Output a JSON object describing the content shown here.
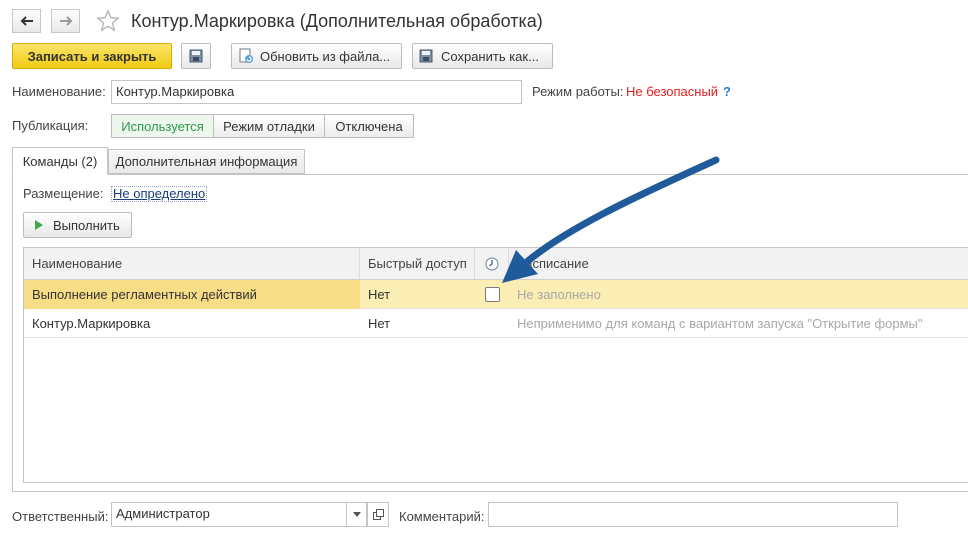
{
  "window": {
    "title": "Контур.Маркировка (Дополнительная обработка)"
  },
  "toolbar": {
    "save_close": "Записать и закрыть",
    "update_from_file": "Обновить из файла...",
    "save_as": "Сохранить как..."
  },
  "form": {
    "name_label": "Наименование:",
    "name_value": "Контур.Маркировка",
    "mode_label": "Режим работы:",
    "mode_value": "Не безопасный",
    "mode_help": "?",
    "publication_label": "Публикация:",
    "publication_options": [
      "Используется",
      "Режим отладки",
      "Отключена"
    ],
    "publication_selected": "Используется"
  },
  "tabs": [
    {
      "label": "Команды (2)",
      "active": true
    },
    {
      "label": "Дополнительная информация",
      "active": false
    }
  ],
  "commands": {
    "placement_label": "Размещение:",
    "placement_value": "Не определено",
    "run_button": "Выполнить",
    "columns": [
      "Наименование",
      "Быстрый доступ",
      "",
      "Расписание"
    ],
    "rows": [
      {
        "name": "Выполнение регламентных действий",
        "quick_access": "Нет",
        "use_schedule": false,
        "schedule": "Не заполнено",
        "selected": true
      },
      {
        "name": "Контур.Маркировка",
        "quick_access": "Нет",
        "use_schedule": null,
        "schedule": "Неприменимо для команд с вариантом запуска \"Открытие формы\"",
        "selected": false
      }
    ]
  },
  "footer": {
    "responsible_label": "Ответственный:",
    "responsible_value": "Администратор",
    "comment_label": "Комментарий:",
    "comment_value": ""
  },
  "colors": {
    "accent_yellow": "#f5d327",
    "selected_row": "#fbeeb5",
    "selected_cell": "#f8dd87",
    "danger_text": "#e02020",
    "link_text": "#1a3e7a",
    "active_segment": "#2c9a4a",
    "annotation_arrow": "#1f5b9a"
  },
  "icons": {
    "back": "arrow-left-icon",
    "forward": "arrow-right-icon",
    "favorite": "star-icon",
    "save": "floppy-disk-icon",
    "update": "file-refresh-icon",
    "save_as": "floppy-disk-icon",
    "run": "play-icon",
    "schedule_column": "clock-icon",
    "dropdown": "chevron-down-icon",
    "open": "open-icon"
  }
}
